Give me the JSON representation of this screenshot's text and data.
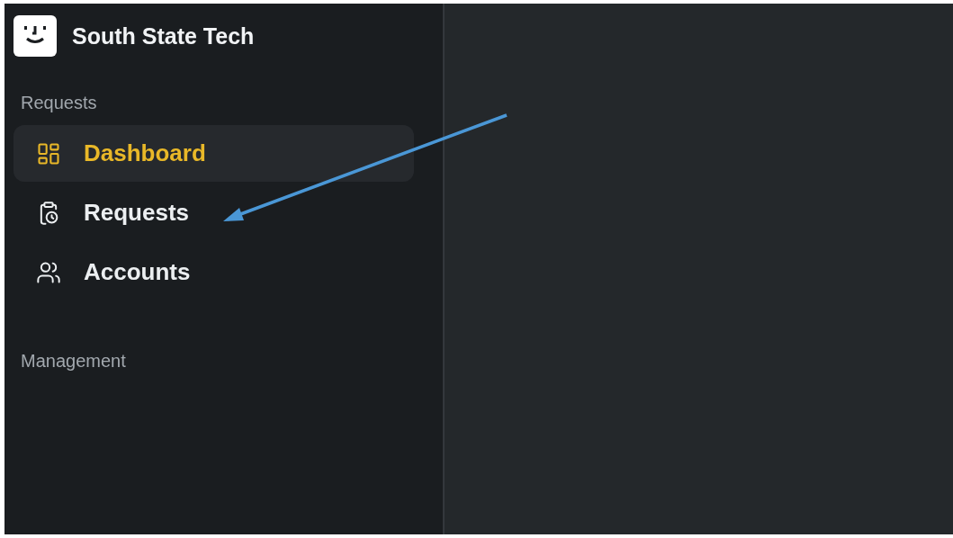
{
  "brand": {
    "name": "South State Tech"
  },
  "sidebar": {
    "sections": [
      {
        "title": "Requests",
        "items": [
          {
            "label": "Dashboard",
            "kind": "dashboard",
            "selected": true
          },
          {
            "label": "Requests",
            "kind": "requests",
            "selected": false
          },
          {
            "label": "Accounts",
            "kind": "accounts",
            "selected": false
          }
        ]
      },
      {
        "title": "Management"
      }
    ]
  }
}
